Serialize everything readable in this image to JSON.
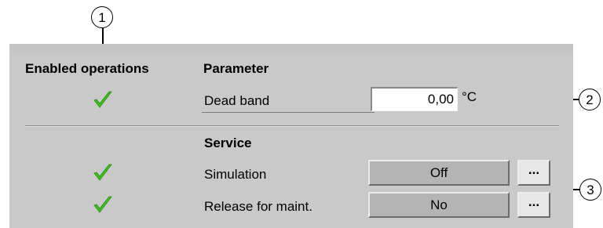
{
  "callouts": {
    "c1": "1",
    "c2": "2",
    "c3": "3"
  },
  "headers": {
    "enabled_operations": "Enabled operations",
    "parameter": "Parameter",
    "service": "Service"
  },
  "parameter": {
    "dead_band_label": "Dead band",
    "dead_band_value": "0,00",
    "dead_band_unit": "°C"
  },
  "service": {
    "simulation_label": "Simulation",
    "simulation_value": "Off",
    "release_label": "Release for maint.",
    "release_value": "No",
    "more_label": "..."
  },
  "colors": {
    "panel": "#c9c9c9",
    "check": "#3fbf1f"
  }
}
